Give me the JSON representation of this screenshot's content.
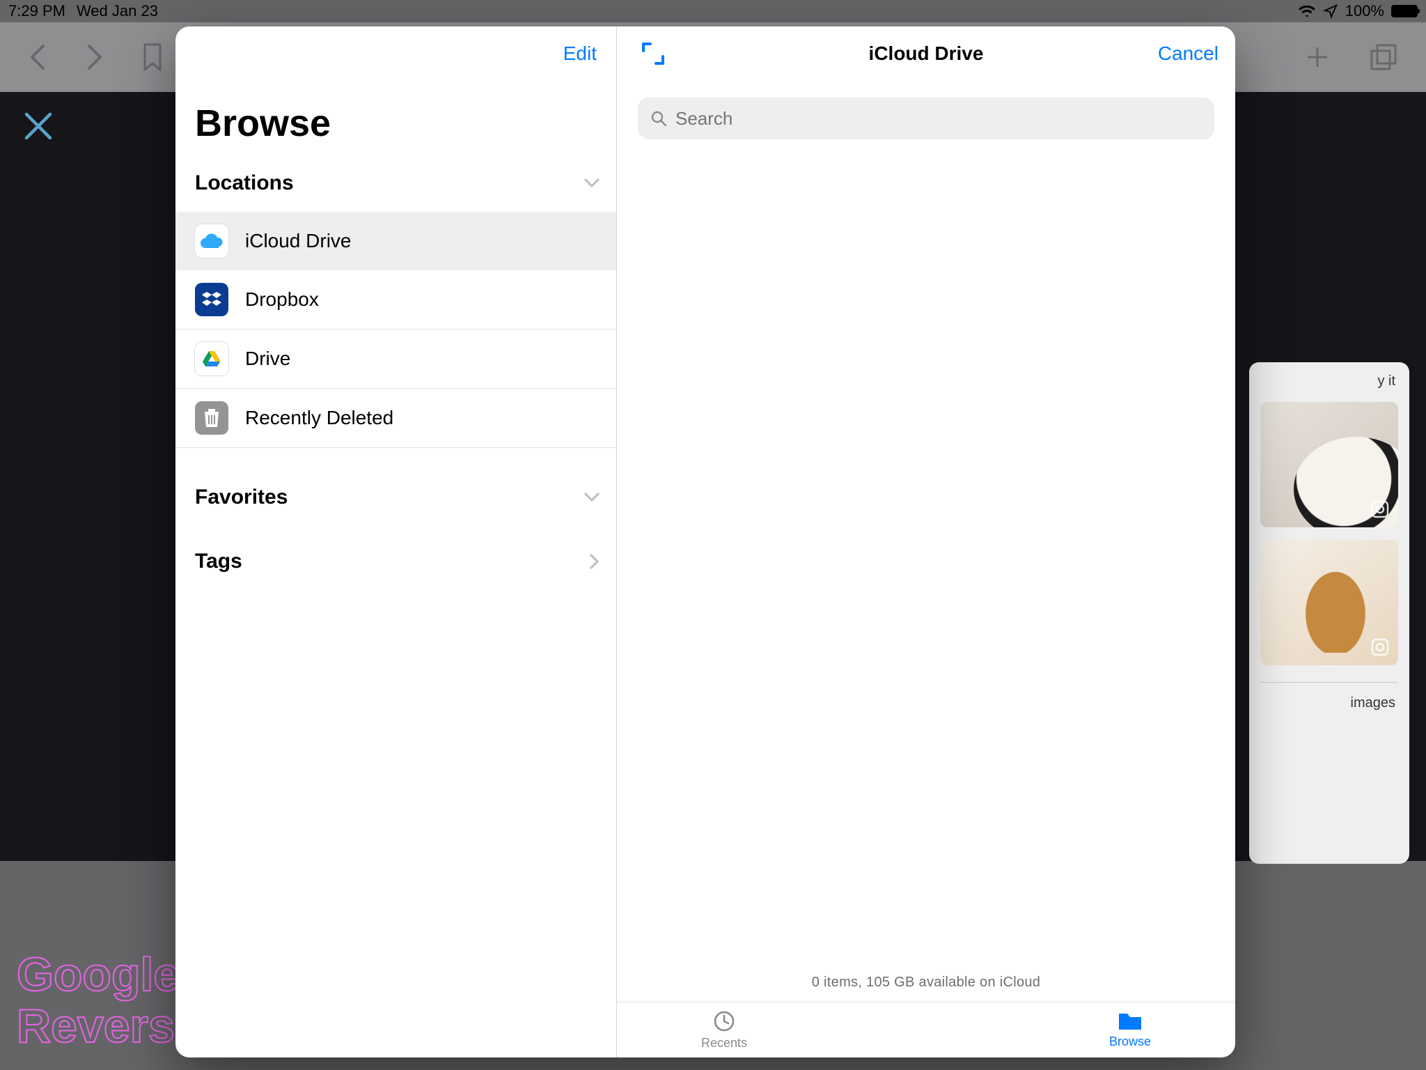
{
  "statusbar": {
    "time": "7:29 PM",
    "date": "Wed Jan 23",
    "battery": "100%"
  },
  "toolbar": {},
  "sidebar": {
    "edit": "Edit",
    "title": "Browse",
    "sections": {
      "locations": "Locations",
      "favorites": "Favorites",
      "tags": "Tags"
    },
    "locations": [
      {
        "label": "iCloud Drive"
      },
      {
        "label": "Dropbox"
      },
      {
        "label": "Drive"
      },
      {
        "label": "Recently Deleted"
      }
    ]
  },
  "main": {
    "title": "iCloud Drive",
    "cancel": "Cancel",
    "search_placeholder": "Search",
    "storage": "0 items, 105 GB available on iCloud"
  },
  "tabs": {
    "recents": "Recents",
    "browse": "Browse"
  },
  "rightcard": {
    "top": "y it",
    "bottom": "images"
  },
  "caption": {
    "l1": "Google Reverse Image Search Upload The",
    "l2": "Reverse Image Search Process Is"
  }
}
